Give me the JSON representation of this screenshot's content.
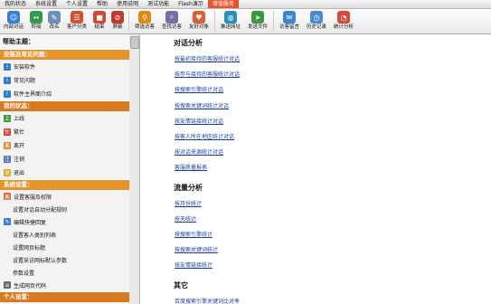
{
  "menubar": {
    "items": [
      "我的状态",
      "系统设置",
      "个人设置",
      "帮助",
      "使用说明",
      "测试功能",
      "Flash演示",
      "增值服务"
    ]
  },
  "toolbar": {
    "buttons": [
      {
        "label": "内部对话",
        "icon": "chat-icon",
        "color": "#3b7fd4"
      },
      {
        "label": "转接",
        "icon": "transfer-icon",
        "color": "#2f9b4a"
      },
      {
        "label": "改名",
        "icon": "rename-icon",
        "color": "#6a8fb8"
      },
      {
        "label": "客户分类",
        "icon": "category-icon",
        "color": "#d4512f"
      },
      {
        "label": "结束",
        "icon": "end-icon",
        "color": "#d44632"
      },
      {
        "label": "屏蔽",
        "icon": "block-icon",
        "color": "#c23a2a"
      },
      {
        "label": "筛选访客",
        "icon": "filter-icon",
        "color": "#e08a1a"
      },
      {
        "label": "查找访客",
        "icon": "search-icon",
        "color": "#7a6aa8"
      },
      {
        "label": "友好对象",
        "icon": "friend-icon",
        "color": "#d95f35"
      },
      {
        "label": "推送网址",
        "icon": "globe-icon",
        "color": "#2a8fb8"
      },
      {
        "label": "发送文件",
        "icon": "send-file-icon",
        "color": "#3a9a3a"
      },
      {
        "label": "访客留言",
        "icon": "message-icon",
        "color": "#3f82d0"
      },
      {
        "label": "历史记录",
        "icon": "history-icon",
        "color": "#4b8ad0"
      },
      {
        "label": "统计分析",
        "icon": "pie-chart-icon",
        "color": "#d64a3a"
      }
    ]
  },
  "sidebar": {
    "title": "帮助主题：",
    "sections": [
      {
        "header": "安装及常见问题：",
        "items": [
          {
            "label": "安装软件",
            "icon": "info-icon"
          },
          {
            "label": "常见问题",
            "icon": "info-icon"
          },
          {
            "label": "软件主界面介绍",
            "icon": "info-icon"
          }
        ]
      },
      {
        "header": "我的状态：",
        "items": [
          {
            "label": "上线",
            "icon": "online-icon"
          },
          {
            "label": "繁忙",
            "icon": "busy-icon"
          },
          {
            "label": "离开",
            "icon": "away-icon"
          },
          {
            "label": "注销",
            "icon": "logout-icon"
          },
          {
            "label": "退出",
            "icon": "exit-icon"
          }
        ]
      },
      {
        "header": "系统设置：",
        "items": [
          {
            "label": "设置客服及权限",
            "icon": "users-icon"
          },
          {
            "label": "设置对话自动分配规则",
            "icon": ""
          },
          {
            "label": "编辑快捷回复",
            "icon": "edit-icon"
          },
          {
            "label": "设置客人类别列表",
            "icon": ""
          },
          {
            "label": "设置网页标题",
            "icon": ""
          },
          {
            "label": "设置采访网标默认参数",
            "icon": ""
          },
          {
            "label": "参数设置",
            "icon": ""
          },
          {
            "label": "生成网页代码",
            "icon": "code-icon"
          }
        ]
      },
      {
        "header": "个人设置：",
        "items": []
      }
    ]
  },
  "content": {
    "groups": [
      {
        "title": "对话分析",
        "links": [
          "按最初接待的客服统计对话",
          "按参与接待的客服统计对话",
          "按搜索引擎统计对话",
          "按搜索关键词统计对话",
          "按友情链接统计对话",
          "按客人所在地区统计对话",
          "按对话来源统计对话",
          "客服质量报表"
        ]
      },
      {
        "title": "流量分析",
        "links": [
          "按月份统计",
          "按天统计",
          "按搜索引擎统计",
          "按搜索关键词统计",
          "按友情链接统计"
        ]
      },
      {
        "title": "其它",
        "links": [
          "百度搜索引擎关键词比对率"
        ]
      }
    ]
  }
}
